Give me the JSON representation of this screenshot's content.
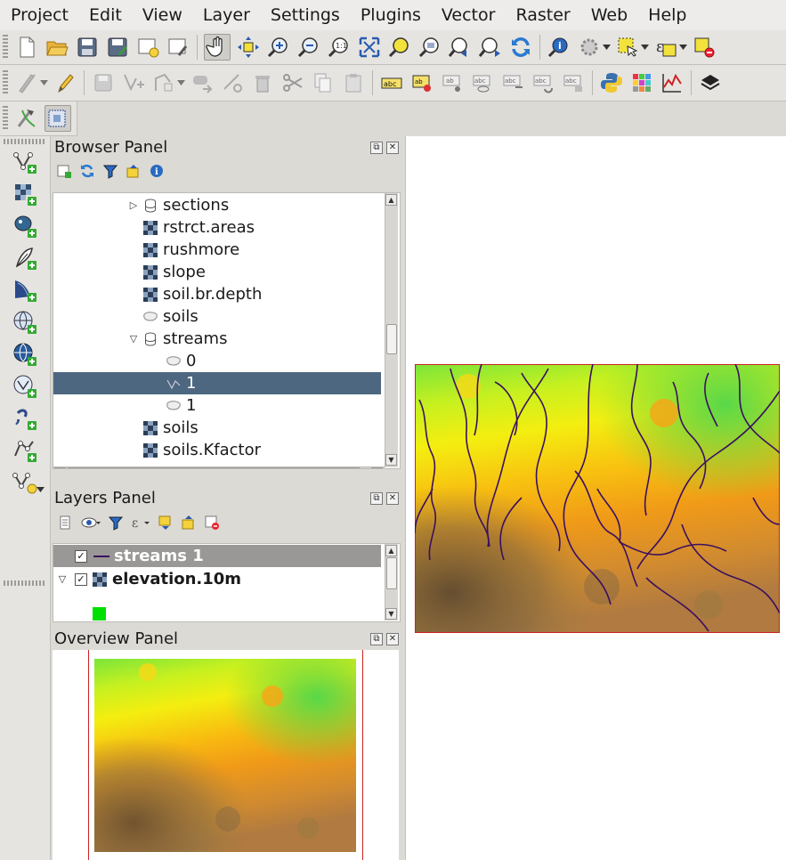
{
  "menubar": {
    "items": [
      "Project",
      "Edit",
      "View",
      "Layer",
      "Settings",
      "Plugins",
      "Vector",
      "Raster",
      "Web",
      "Help"
    ]
  },
  "browser_panel": {
    "title": "Browser Panel",
    "items": [
      {
        "label": "sections",
        "icon": "database-icon",
        "indent": 1,
        "expander": "collapsed"
      },
      {
        "label": "rstrct.areas",
        "icon": "raster-layer-icon",
        "indent": 1
      },
      {
        "label": "rushmore",
        "icon": "raster-layer-icon",
        "indent": 1
      },
      {
        "label": "slope",
        "icon": "raster-layer-icon",
        "indent": 1
      },
      {
        "label": "soil.br.depth",
        "icon": "raster-layer-icon",
        "indent": 1
      },
      {
        "label": "soils",
        "icon": "polygon-layer-icon",
        "indent": 1
      },
      {
        "label": "streams",
        "icon": "database-icon",
        "indent": 1,
        "expander": "expanded"
      },
      {
        "label": "0",
        "icon": "polygon-layer-icon",
        "indent": 2
      },
      {
        "label": "1",
        "icon": "line-layer-icon",
        "indent": 2,
        "selected": true
      },
      {
        "label": "1",
        "icon": "polygon-layer-icon",
        "indent": 2
      },
      {
        "label": "soils",
        "icon": "raster-layer-icon",
        "indent": 1
      },
      {
        "label": "soils.Kfactor",
        "icon": "raster-layer-icon",
        "indent": 1
      }
    ]
  },
  "layers_panel": {
    "title": "Layers Panel",
    "layers": [
      {
        "label": "streams 1",
        "checked": true,
        "icon": "line-symbol-icon",
        "selected": true
      },
      {
        "label": "elevation.10m",
        "checked": true,
        "icon": "raster-layer-icon",
        "expander": "expanded"
      }
    ],
    "legend_color": "#00e000"
  },
  "overview_panel": {
    "title": "Overview Panel"
  },
  "colors": {
    "selection": "#4d6780",
    "stream_line": "#3a1060",
    "extent_border": "#cc2222"
  }
}
